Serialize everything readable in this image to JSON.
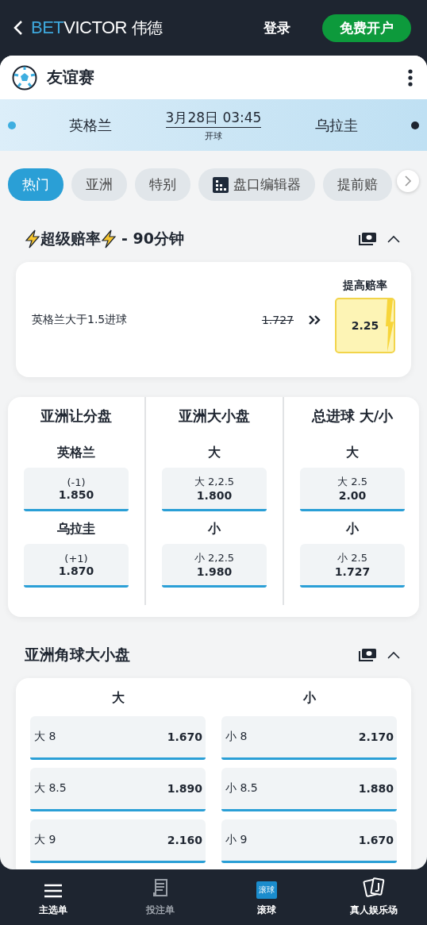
{
  "header": {
    "logo": {
      "accent": "BET",
      "main": "VICTOR",
      "suffix": "伟德"
    },
    "login": "登录",
    "register": "免费开户"
  },
  "competition": {
    "title": "友谊赛"
  },
  "match": {
    "home": {
      "name": "英格兰",
      "color": "#3eaee0"
    },
    "away": {
      "name": "乌拉圭",
      "color": "#1e2530"
    },
    "time": "3月28日 03:45",
    "status": "开球"
  },
  "tabs": [
    {
      "label": "热门",
      "selected": true
    },
    {
      "label": "亚洲",
      "selected": false
    },
    {
      "label": "特别",
      "selected": false
    },
    {
      "label": "盘口编辑器",
      "selected": false,
      "kind": "builder"
    },
    {
      "label": "提前赔",
      "selected": false
    }
  ],
  "boost": {
    "title": "超级赔率",
    "subtitle": "- 90分钟",
    "expanded": true,
    "label": "提高赔率",
    "selection": "英格兰大于1.5进球",
    "old_price": "1.727",
    "new_price": "2.25"
  },
  "markets": [
    {
      "title": "亚洲让分盘",
      "rows": [
        {
          "label": "英格兰",
          "line": "(-1)",
          "price": "1.850"
        },
        {
          "label": "乌拉圭",
          "line": "(+1)",
          "price": "1.870"
        }
      ]
    },
    {
      "title": "亚洲大小盘",
      "rows": [
        {
          "label": "大",
          "line": "大 2,2.5",
          "price": "1.800"
        },
        {
          "label": "小",
          "line": "小 2,2.5",
          "price": "1.980"
        }
      ]
    },
    {
      "title": "总进球 大/小",
      "rows": [
        {
          "label": "大",
          "line": "大 2.5",
          "price": "2.00"
        },
        {
          "label": "小",
          "line": "小 2.5",
          "price": "1.727"
        }
      ]
    }
  ],
  "corners": {
    "title": "亚洲角球大小盘",
    "expanded": true,
    "columns": [
      {
        "heading": "大",
        "options": [
          {
            "label": "大 8",
            "price": "1.670"
          },
          {
            "label": "大 8.5",
            "price": "1.890"
          },
          {
            "label": "大 9",
            "price": "2.160"
          }
        ]
      },
      {
        "heading": "小",
        "options": [
          {
            "label": "小 8",
            "price": "2.170"
          },
          {
            "label": "小 8.5",
            "price": "1.880"
          },
          {
            "label": "小 9",
            "price": "1.670"
          }
        ]
      }
    ]
  },
  "nav": [
    {
      "kind": "menu",
      "label": "主选单",
      "disabled": false
    },
    {
      "kind": "betslip",
      "label": "投注单",
      "disabled": true
    },
    {
      "kind": "live",
      "label": "滚球",
      "icon_text": "滚球",
      "disabled": false
    },
    {
      "kind": "casino",
      "label": "真人娱乐场",
      "disabled": false
    }
  ]
}
